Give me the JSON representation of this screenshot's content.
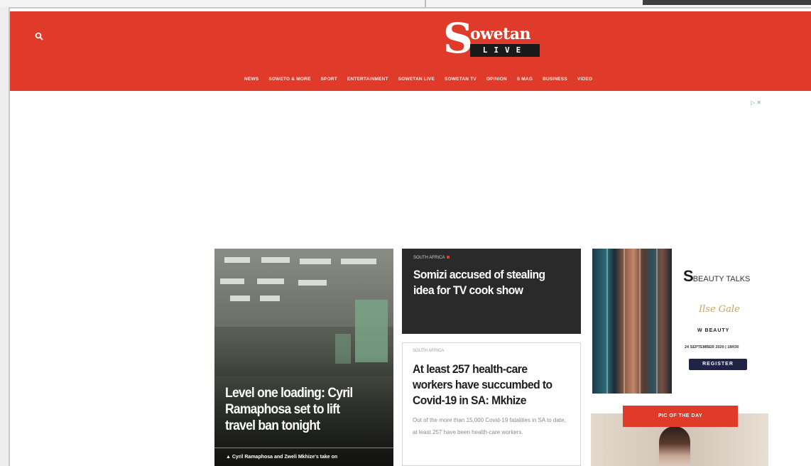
{
  "browser": {
    "visible_content": ""
  },
  "header": {
    "logo_big": "S",
    "logo_owetan": "owetan",
    "logo_live": "LIVE",
    "nav": [
      "News",
      "Soweto & More",
      "Sport",
      "Entertainment",
      "Sowetan Live",
      "Sowetan TV",
      "Opinion",
      "S Mag",
      "Business",
      "Video"
    ]
  },
  "ad": {
    "adchoices": "▷ ✕"
  },
  "hero": {
    "title": "Level one loading: Cyril Ramaphosa set to lift travel ban tonight",
    "sub": "▲ Cyril Ramaphosa and Zweli Mkhize's take on"
  },
  "card1": {
    "kicker": "South Africa",
    "title": "Somizi accused of stealing idea for TV cook show"
  },
  "card2": {
    "kicker": "South Africa",
    "title": "At least 257 health-care workers have succumbed to Covid-19 in SA: Mkhize",
    "summary": "Out of the more than 15,000 Covid-19 fatalities in SA to date, at least 257 have been health-care workers."
  },
  "beauty_ad": {
    "brand": "S",
    "brand_words": "BEAUTY TALKS",
    "script": "Ilse Gale",
    "line1": "W BEAUTY",
    "line2": "24 SEPTEMBER 2020 | 18H30",
    "button": "REGISTER"
  },
  "potd": {
    "label": "Pic of the day"
  },
  "colors": {
    "brand_red": "#e03a2b",
    "dark_card": "#2a2a2a",
    "register_button": "#1f2446"
  }
}
